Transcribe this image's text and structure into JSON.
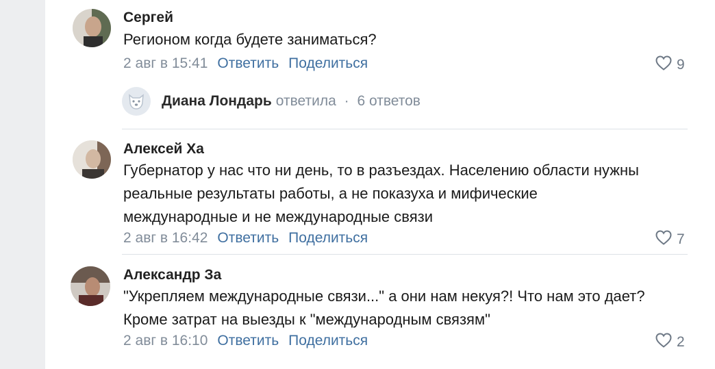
{
  "comments": [
    {
      "author": "Сергей",
      "lines": [
        "Регионом когда будете заниматься?"
      ],
      "date": "2 авг в 15:41",
      "reply_label": "Ответить",
      "share_label": "Поделиться",
      "likes": "9"
    },
    {
      "author": "Алексей Ха",
      "lines": [
        "Губернатор у нас что ни день, то в разъездах. Населению области нужны",
        "реальные результаты работы, а не показуха и мифические",
        "международные и не международные связи"
      ],
      "date": "2 авг в 16:42",
      "reply_label": "Ответить",
      "share_label": "Поделиться",
      "likes": "7"
    },
    {
      "author": "Александр За",
      "lines": [
        "\"Укрепляем международные связи...\" а они нам некуя?! Что нам это дает?",
        "Кроме затрат на выезды к \"международным связям\""
      ],
      "date": "2 авг в 16:10",
      "reply_label": "Ответить",
      "share_label": "Поделиться",
      "likes": "2"
    }
  ],
  "thread_reply": {
    "name": "Диана Лондарь",
    "action": "ответила",
    "separator": "·",
    "count": "6 ответов"
  },
  "colors": {
    "link": "#3f6fa0",
    "meta": "#818c99",
    "background": "#edeef0"
  },
  "icons": {
    "like": "heart-outline-icon",
    "reply_avatar": "dog-avatar-icon"
  }
}
